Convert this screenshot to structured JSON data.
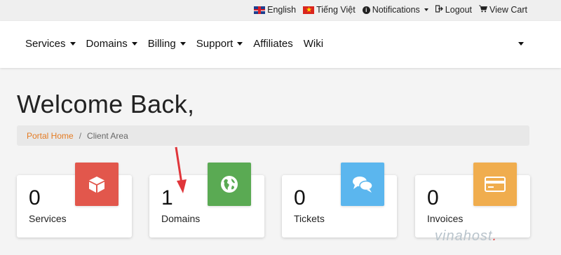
{
  "topbar": {
    "language_en": "English",
    "language_vi": "Tiếng Việt",
    "notifications": "Notifications",
    "logout": "Logout",
    "view_cart": "View Cart"
  },
  "nav": {
    "items": [
      {
        "label": "Services",
        "dropdown": true
      },
      {
        "label": "Domains",
        "dropdown": true
      },
      {
        "label": "Billing",
        "dropdown": true
      },
      {
        "label": "Support",
        "dropdown": true
      },
      {
        "label": "Affiliates",
        "dropdown": false
      },
      {
        "label": "Wiki",
        "dropdown": false
      }
    ]
  },
  "page": {
    "title": "Welcome Back,",
    "breadcrumb": {
      "home": "Portal Home",
      "separator": "/",
      "current": "Client Area"
    }
  },
  "tiles": [
    {
      "count": "0",
      "label": "Services",
      "color": "#e2574c",
      "icon": "cube-icon"
    },
    {
      "count": "1",
      "label": "Domains",
      "color": "#5aaa53",
      "icon": "globe-icon"
    },
    {
      "count": "0",
      "label": "Tickets",
      "color": "#5bb6ee",
      "icon": "comments-icon"
    },
    {
      "count": "0",
      "label": "Invoices",
      "color": "#f0ad4e",
      "icon": "credit-card-icon"
    }
  ],
  "watermark": {
    "text": "vinahost",
    "dot": "."
  },
  "colors": {
    "accent_link": "#e47b23",
    "annotation_arrow": "#e0353a"
  }
}
